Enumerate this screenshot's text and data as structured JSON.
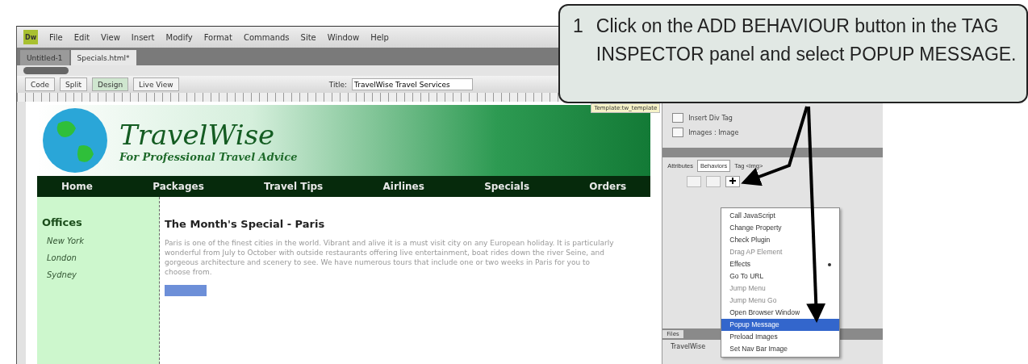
{
  "app": {
    "logo": "Dw",
    "menu": [
      "File",
      "Edit",
      "View",
      "Insert",
      "Modify",
      "Format",
      "Commands",
      "Site",
      "Window",
      "Help"
    ],
    "doc_tabs": [
      {
        "label": "Untitled-1",
        "selected": false
      },
      {
        "label": "Specials.html*",
        "selected": true
      }
    ],
    "view_buttons": [
      {
        "label": "Code",
        "selected": false
      },
      {
        "label": "Split",
        "selected": false
      },
      {
        "label": "Design",
        "selected": true
      },
      {
        "label": "Live View",
        "selected": false
      }
    ],
    "title_label": "Title:",
    "title_value": "TravelWise Travel Services"
  },
  "page": {
    "template_label": "Template:tw_template",
    "site_title": "TravelWise",
    "tagline": "For Professional Travel Advice",
    "nav": [
      "Home",
      "Packages",
      "Travel Tips",
      "Airlines",
      "Specials",
      "Orders"
    ],
    "sidebar_heading": "Offices",
    "sidebar_items": [
      "New York",
      "London",
      "Sydney"
    ],
    "heading": "The Month's Special - Paris",
    "paragraph": "Paris is one of the finest cities in the world. Vibrant and alive it is a must visit city on any European holiday. It is particularly wonderful from July to October with outside restaurants offering live entertainment, boat rides down the river Seine, and gorgeous architecture and scenery to see. We have numerous tours that include one or two weeks in Paris for you to choose from."
  },
  "panel": {
    "insert_items": [
      "Insert Div Tag",
      "Images : Image"
    ],
    "inspector_tabs": [
      {
        "label": "Attributes",
        "selected": false
      },
      {
        "label": "Behaviors",
        "selected": true
      },
      {
        "label": "Tag <img>",
        "selected": false
      }
    ],
    "behavior_menu": [
      {
        "label": "Call JavaScript",
        "disabled": false,
        "selected": false,
        "submenu": false
      },
      {
        "label": "Change Property",
        "disabled": false,
        "selected": false,
        "submenu": false
      },
      {
        "label": "Check Plugin",
        "disabled": false,
        "selected": false,
        "submenu": false
      },
      {
        "label": "Drag AP Element",
        "disabled": true,
        "selected": false,
        "submenu": false
      },
      {
        "label": "Effects",
        "disabled": false,
        "selected": false,
        "submenu": true
      },
      {
        "label": "Go To URL",
        "disabled": false,
        "selected": false,
        "submenu": false
      },
      {
        "label": "Jump Menu",
        "disabled": true,
        "selected": false,
        "submenu": false
      },
      {
        "label": "Jump Menu Go",
        "disabled": true,
        "selected": false,
        "submenu": false
      },
      {
        "label": "Open Browser Window",
        "disabled": false,
        "selected": false,
        "submenu": false
      },
      {
        "label": "Popup Message",
        "disabled": false,
        "selected": true,
        "submenu": false
      },
      {
        "label": "Preload Images",
        "disabled": false,
        "selected": false,
        "submenu": false
      },
      {
        "label": "Set Nav Bar Image",
        "disabled": false,
        "selected": false,
        "submenu": false
      }
    ],
    "files_tab": "Files",
    "files_site": "TravelWise"
  },
  "callout": {
    "number": "1",
    "text": "Click on the ADD BEHAVIOUR button in the TAG INSPECTOR panel and select POPUP MESSAGE."
  }
}
